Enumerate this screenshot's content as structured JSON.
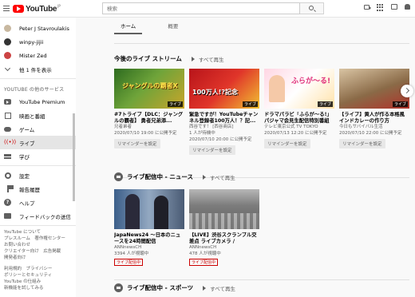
{
  "header": {
    "logo_text": "YouTube",
    "logo_sup": "JP",
    "search_placeholder": "検索"
  },
  "sidebar": {
    "subscriptions": [
      {
        "name": "Peter J Stavroulakis"
      },
      {
        "name": "winpy-jijii"
      },
      {
        "name": "Mister Zed"
      }
    ],
    "show_more": "他 1 件を表示",
    "section_title": "YOUTUBE の他のサービス",
    "services": [
      {
        "label": "YouTube Premium"
      },
      {
        "label": "映画と番組"
      },
      {
        "label": "ゲーム"
      },
      {
        "label": "ライブ"
      },
      {
        "label": "学び"
      }
    ],
    "settings": [
      {
        "label": "設定"
      },
      {
        "label": "報告履歴"
      },
      {
        "label": "ヘルプ"
      },
      {
        "label": "フィードバックの送信"
      }
    ],
    "footer": [
      "YouTube について",
      "プレスルーム　著作権センター",
      "お問い合わせ",
      "クリエイター向け　広告掲載",
      "開発者向け",
      "",
      "利用規約　プライバシー",
      "ポリシーとセキュリティ",
      "YouTube の仕組み",
      "新機能を試してみる"
    ]
  },
  "main": {
    "tabs": [
      {
        "label": "ホーム"
      },
      {
        "label": "概要"
      }
    ],
    "upcoming_shelf": {
      "title": "今後のライブ ストリーム",
      "play_all": "すべて再生",
      "videos": [
        {
          "thumb_text": "ジャングルの覇者X",
          "badge": "ライブ",
          "title": "#7トライブ【DLC：ジャングルの覇者】 勇者兄弟添...",
          "channel": "兄者弟者",
          "scheduled": "2020/07/10 19:00 に公開予定",
          "remind": "リマインダーを設定"
        },
        {
          "thumb_text": "100万人!?記念",
          "badge": "ライブ",
          "title": "緊急ですが！YouTubeチャンネル登録者100万人！？記...",
          "channel": "西谷です！ [西谷商店]",
          "scheduled": "1 人が待機中",
          "sub": "2020/07/10 20:00 に公開予定",
          "remind": "リマインダーを設定"
        },
        {
          "thumb_text": "ふらが〜る!",
          "badge": "ライブ",
          "title": "ドラマパラビ「ふらが〜る!」パジャマ会見生配信特別番組",
          "channel": "テレビ東京公式 TV TOKYO",
          "scheduled": "2020/07/13 12:20 に公開予定",
          "remind": "リマインダーを設定"
        },
        {
          "thumb_text": "",
          "badge": "ライブ",
          "title": "【ライブ】黄人が作る本格風インドカレーの作り方",
          "channel": "今日もサバイバル生活",
          "scheduled": "2020/07/10 22:00 に公開予定",
          "remind": "リマインダーを設定"
        }
      ]
    },
    "news_shelf": {
      "title": "ライブ配信中 - ニュース",
      "play_all": "すべて再生",
      "videos": [
        {
          "title": "JapaNews24 ～日本のニュースを24時間配信",
          "channel": "ANNnewsCH",
          "viewers": "3394 人が視聴中",
          "live": "ライブ配信中"
        },
        {
          "title": "【LIVE】渋谷スクランブル交差点 ライブカメラ / Shibuy...",
          "channel": "ANNnewsCH",
          "viewers": "478 人が視聴中",
          "live": "ライブ配信中"
        }
      ]
    },
    "sports_shelf": {
      "title": "ライブ配信中 - スポーツ",
      "play_all": "すべて再生"
    }
  }
}
